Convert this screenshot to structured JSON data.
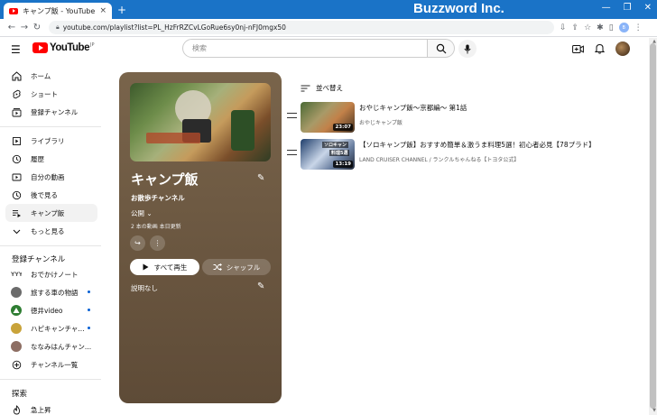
{
  "browser": {
    "tab_title": "キャンプ飯 - YouTube",
    "tab_close": "×",
    "new_tab": "+",
    "brand": "Buzzword Inc.",
    "window_controls": [
      "—",
      "❐",
      "✕"
    ],
    "url": "youtube.com/playlist?list=PL_HzFrRZCvLGoRue6sy0nj-nFJ0mgx50",
    "profile_initial": "B"
  },
  "header": {
    "logo_text": "YouTube",
    "logo_sup": "JP",
    "search_placeholder": "検索"
  },
  "sidebar": {
    "main_items": [
      {
        "label": "ホーム",
        "icon": "home-icon"
      },
      {
        "label": "ショート",
        "icon": "shorts-icon"
      },
      {
        "label": "登録チャンネル",
        "icon": "subscriptions-icon"
      }
    ],
    "library_items": [
      {
        "label": "ライブラリ",
        "icon": "library-icon"
      },
      {
        "label": "履歴",
        "icon": "history-icon"
      },
      {
        "label": "自分の動画",
        "icon": "my-videos-icon"
      },
      {
        "label": "後で見る",
        "icon": "watch-later-icon"
      },
      {
        "label": "キャンプ飯",
        "icon": "playlist-icon"
      },
      {
        "label": "もっと見る",
        "icon": "chevron-down-icon"
      }
    ],
    "subscriptions_heading": "登録チャンネル",
    "subscriptions": [
      {
        "label": "おでかけノート",
        "color": "#555555",
        "live": false
      },
      {
        "label": "旅する車の物語",
        "color": "#6b6b6b",
        "live": true
      },
      {
        "label": "徳井video",
        "color": "#2e7d32",
        "live": true
      },
      {
        "label": "ハピキャンチャ...",
        "color": "#c9a33a",
        "live": true
      },
      {
        "label": "ななみはんチャン...",
        "color": "#8d6e63",
        "live": false
      },
      {
        "label": "チャンネル一覧",
        "color": "",
        "live": false
      }
    ],
    "explore_heading": "探索",
    "explore_items": [
      {
        "label": "急上昇",
        "icon": "trending-icon"
      }
    ]
  },
  "playlist": {
    "title": "キャンプ飯",
    "owner": "お散歩チャンネル",
    "privacy": "公開",
    "meta": "2 本の動画  本日更新",
    "play_all_label": "すべて再生",
    "shuffle_label": "シャッフル",
    "description": "説明なし",
    "panel_color": "#6e5a43"
  },
  "sort_label": "並べ替え",
  "videos": [
    {
      "title": "おやじキャンプ飯〜京都編〜 第1話",
      "channel": "おやじキャンプ飯",
      "duration": "23:07"
    },
    {
      "title": "【ソロキャンプ飯】おすすめ簡単＆激うま料理5選！初心者必見【78プラド】",
      "channel": "LAND CRUISER CHANNEL / ランクルちゃんねる【トヨタ公式】",
      "duration": "13:19",
      "overlay_1": "ソロキャン",
      "overlay_2": "料理5選"
    }
  ]
}
